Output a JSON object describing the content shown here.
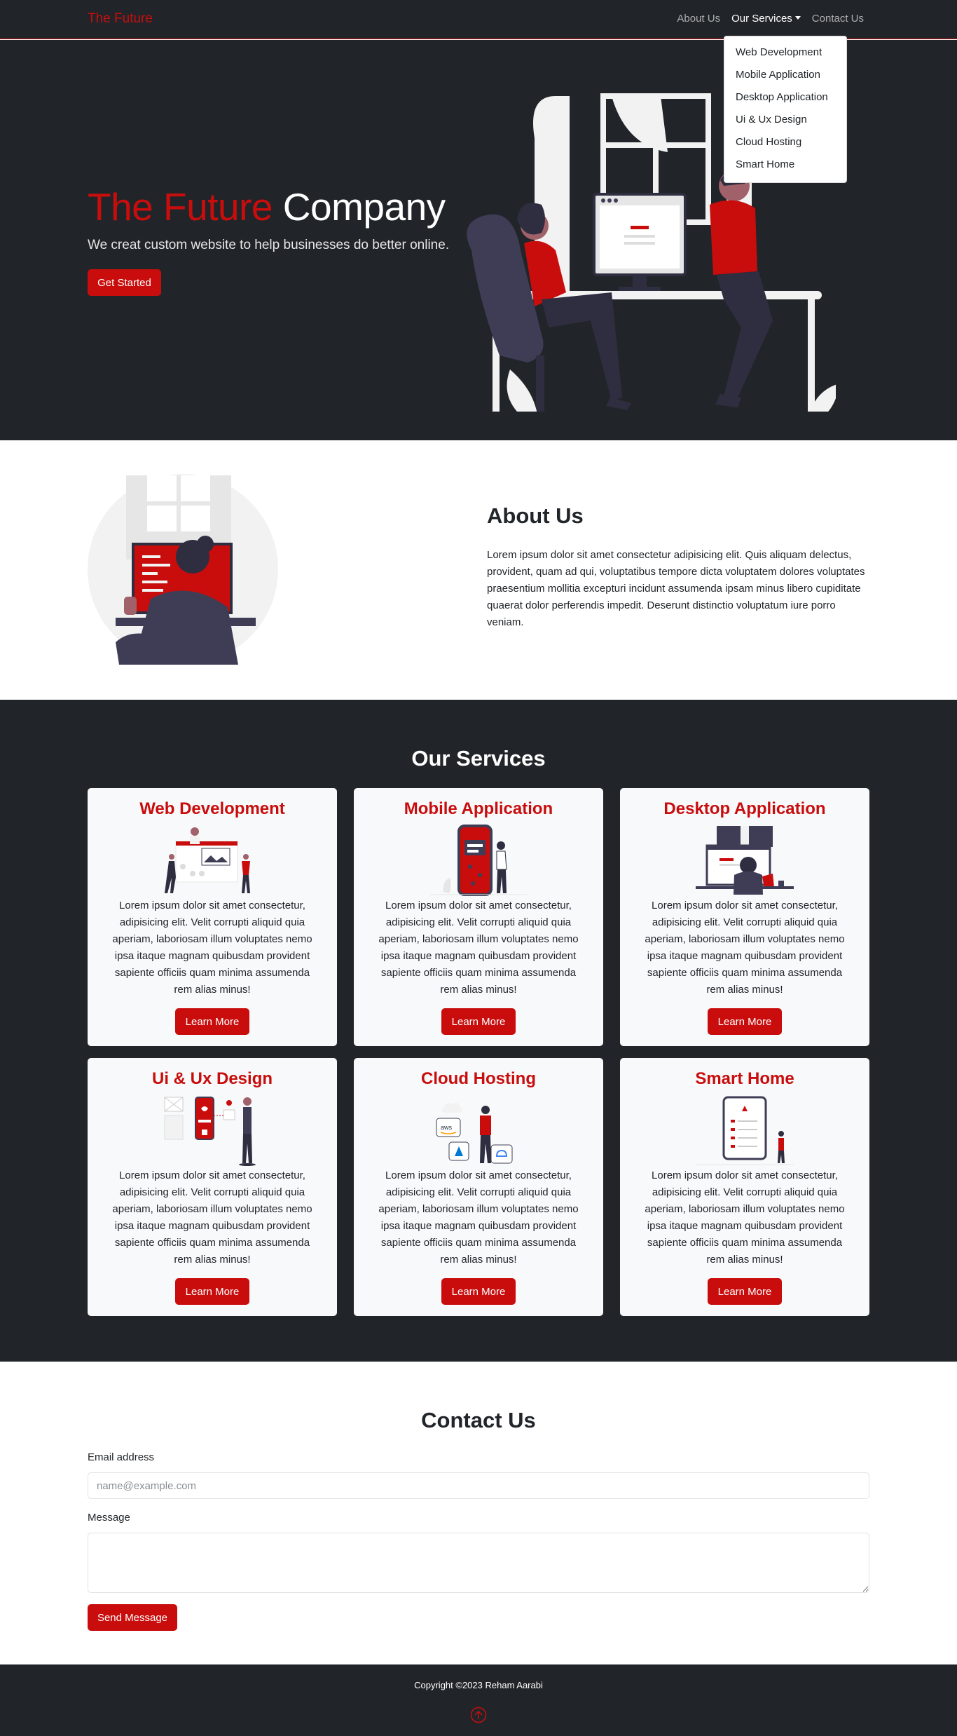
{
  "navbar": {
    "brand": "The Future",
    "links": [
      {
        "label": "About Us"
      },
      {
        "label": "Our Services"
      },
      {
        "label": "Contact Us"
      }
    ],
    "dropdown": [
      "Web Development",
      "Mobile Application",
      "Desktop Application",
      "Ui & Ux Design",
      "Cloud Hosting",
      "Smart Home"
    ]
  },
  "hero": {
    "title_red": "The Future",
    "title_white": "Company",
    "subtitle": "We creat custom website to help businesses do better online.",
    "button": "Get Started"
  },
  "about": {
    "title": "About Us",
    "text": "Lorem ipsum dolor sit amet consectetur adipisicing elit. Quis aliquam delectus, provident, quam ad qui, voluptatibus tempore dicta voluptatem dolores voluptates praesentium mollitia excepturi incidunt assumenda ipsam minus libero cupiditate quaerat dolor perferendis impedit. Deserunt distinctio voluptatum iure porro veniam."
  },
  "services": {
    "title": "Our Services",
    "cards": [
      {
        "title": "Web Development",
        "text": "Lorem ipsum dolor sit amet consectetur, adipisicing elit. Velit corrupti aliquid quia aperiam, laboriosam illum voluptates nemo ipsa itaque magnam quibusdam provident sapiente officiis quam minima assumenda rem alias minus!",
        "button": "Learn More"
      },
      {
        "title": "Mobile Application",
        "text": "Lorem ipsum dolor sit amet consectetur, adipisicing elit. Velit corrupti aliquid quia aperiam, laboriosam illum voluptates nemo ipsa itaque magnam quibusdam provident sapiente officiis quam minima assumenda rem alias minus!",
        "button": "Learn More"
      },
      {
        "title": "Desktop Application",
        "text": "Lorem ipsum dolor sit amet consectetur, adipisicing elit. Velit corrupti aliquid quia aperiam, laboriosam illum voluptates nemo ipsa itaque magnam quibusdam provident sapiente officiis quam minima assumenda rem alias minus!",
        "button": "Learn More"
      },
      {
        "title": "Ui & Ux Design",
        "text": "Lorem ipsum dolor sit amet consectetur, adipisicing elit. Velit corrupti aliquid quia aperiam, laboriosam illum voluptates nemo ipsa itaque magnam quibusdam provident sapiente officiis quam minima assumenda rem alias minus!",
        "button": "Learn More"
      },
      {
        "title": "Cloud Hosting",
        "text": "Lorem ipsum dolor sit amet consectetur, adipisicing elit. Velit corrupti aliquid quia aperiam, laboriosam illum voluptates nemo ipsa itaque magnam quibusdam provident sapiente officiis quam minima assumenda rem alias minus!",
        "button": "Learn More"
      },
      {
        "title": "Smart Home",
        "text": "Lorem ipsum dolor sit amet consectetur, adipisicing elit. Velit corrupti aliquid quia aperiam, laboriosam illum voluptates nemo ipsa itaque magnam quibusdam provident sapiente officiis quam minima assumenda rem alias minus!",
        "button": "Learn More"
      }
    ]
  },
  "contact": {
    "title": "Contact Us",
    "email_label": "Email address",
    "email_placeholder": "name@example.com",
    "message_label": "Message",
    "button": "Send Message"
  },
  "footer": {
    "copyright": "Copyright ©2023 Reham Aarabi"
  },
  "colors": {
    "accent": "#c90d0d",
    "dark": "#212529",
    "card": "#f8f9fa"
  }
}
